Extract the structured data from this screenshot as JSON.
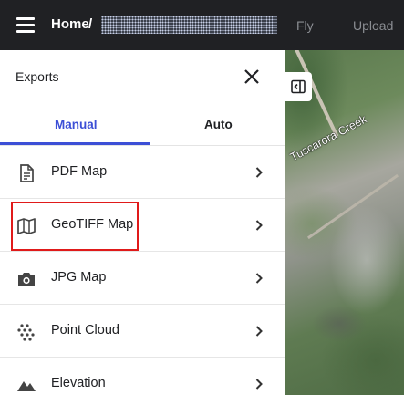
{
  "header": {
    "breadcrumb_home": "Home",
    "breadcrumb_sep": "/",
    "nav_fly": "Fly",
    "nav_upload": "Upload"
  },
  "panel": {
    "title": "Exports",
    "tabs": [
      {
        "label": "Manual",
        "active": true
      },
      {
        "label": "Auto",
        "active": false
      }
    ],
    "items": [
      {
        "label": "PDF Map",
        "icon": "pdf-file-icon"
      },
      {
        "label": "GeoTIFF Map",
        "icon": "map-icon",
        "highlighted": true
      },
      {
        "label": "JPG Map",
        "icon": "camera-icon"
      },
      {
        "label": "Point Cloud",
        "icon": "point-cloud-icon"
      },
      {
        "label": "Elevation",
        "icon": "mountain-icon"
      }
    ]
  },
  "map": {
    "label": "Tuscarora Creek"
  },
  "colors": {
    "accent": "#3c4fd6",
    "highlight": "#e01a1a",
    "topbar": "#202124"
  }
}
